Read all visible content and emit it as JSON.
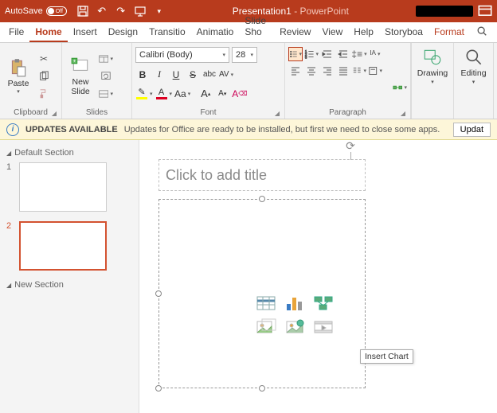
{
  "titlebar": {
    "autosave_label": "AutoSave",
    "autosave_state": "Off",
    "doc_name": "Presentation1",
    "app_name": "PowerPoint"
  },
  "tabs": [
    "File",
    "Home",
    "Insert",
    "Design",
    "Transitio",
    "Animatio",
    "Slide Sho",
    "Review",
    "View",
    "Help",
    "Storyboa",
    "Format"
  ],
  "active_tab": "Home",
  "ribbon": {
    "clipboard": {
      "paste": "Paste",
      "label": "Clipboard"
    },
    "slides": {
      "new_slide": "New\nSlide",
      "label": "Slides"
    },
    "font": {
      "name": "Calibri (Body)",
      "size": "28",
      "bold": "B",
      "italic": "I",
      "underline": "U",
      "strike": "S",
      "shadow": "abc",
      "spacing": "AV",
      "case": "Aa",
      "grow": "A",
      "shrink": "A",
      "clear": "A",
      "label": "Font"
    },
    "paragraph": {
      "label": "Paragraph"
    },
    "drawing": {
      "btn": "Drawing",
      "label": ""
    },
    "editing": {
      "btn": "Editing",
      "label": ""
    }
  },
  "updates": {
    "title": "UPDATES AVAILABLE",
    "msg": "Updates for Office are ready to be installed, but first we need to close some apps.",
    "btn": "Updat"
  },
  "panel": {
    "section1": "Default Section",
    "section2": "New Section",
    "slides": [
      {
        "n": "1"
      },
      {
        "n": "2"
      }
    ]
  },
  "slide": {
    "title_placeholder": "Click to add title",
    "tooltip": "Insert Chart"
  }
}
